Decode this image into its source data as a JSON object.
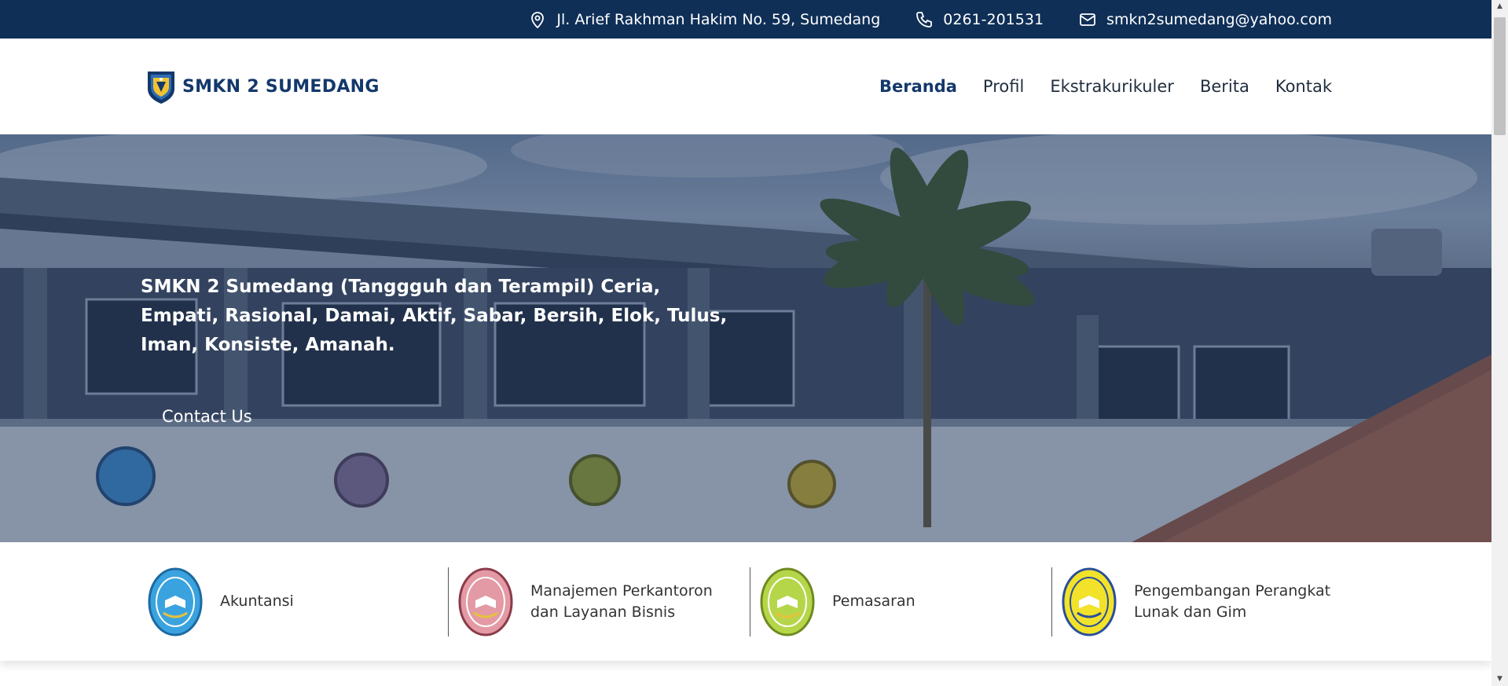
{
  "topbar": {
    "address": "Jl. Arief Rakhman Hakim No. 59, Sumedang",
    "phone": "0261-201531",
    "email": "smkn2sumedang@yahoo.com",
    "icons": [
      "location-pin-icon",
      "phone-icon",
      "envelope-icon"
    ]
  },
  "brand": {
    "name": "SMKN 2 SUMEDANG"
  },
  "nav": {
    "items": [
      "Beranda",
      "Profil",
      "Ekstrakurikuler",
      "Berita",
      "Kontak"
    ],
    "active": "Beranda"
  },
  "hero": {
    "heading": "SMKN 2 Sumedang (Tanggguh dan Terampil) Ceria, Empati, Rasional, Damai, Aktif, Sabar, Bersih, Elok, Tulus, Iman, Konsiste, Amanah.",
    "button_label": "Contact Us"
  },
  "programs": [
    {
      "label": "Akuntansi",
      "badge_color": "#3aa3df"
    },
    {
      "label": "Manajemen Perkantoron dan Layanan Bisnis",
      "badge_color": "#e39aa5"
    },
    {
      "label": "Pemasaran",
      "badge_color": "#b6d64a"
    },
    {
      "label": "Pengembangan Perangkat Lunak dan Gim",
      "badge_color": "#f2e22a"
    }
  ],
  "colors": {
    "topbar_bg": "#0f2f57",
    "brand_text": "#13386b"
  }
}
